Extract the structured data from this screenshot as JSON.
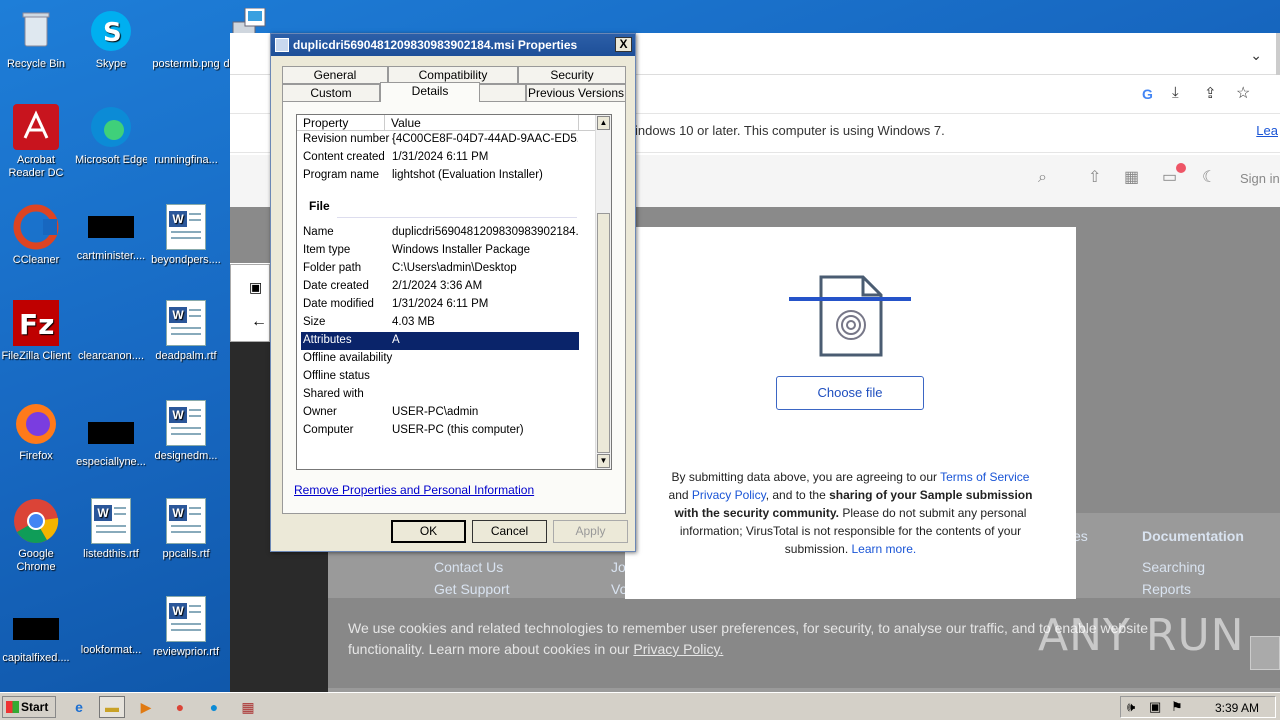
{
  "desktop": {
    "icons": [
      {
        "label": "Recycle Bin"
      },
      {
        "label": "Skype"
      },
      {
        "label": "postermb.png"
      },
      {
        "label": "duplicdri5"
      },
      {
        "label": "Acrobat Reader DC"
      },
      {
        "label": "Microsoft Edge"
      },
      {
        "label": "runningfina..."
      },
      {
        "label": "CCleaner"
      },
      {
        "label": "cartminister...."
      },
      {
        "label": "beyondpers...."
      },
      {
        "label": "FileZilla Client"
      },
      {
        "label": "clearcanon...."
      },
      {
        "label": "deadpalm.rtf"
      },
      {
        "label": "Firefox"
      },
      {
        "label": "especiallyne..."
      },
      {
        "label": "designedm..."
      },
      {
        "label": "Google Chrome"
      },
      {
        "label": "listedthis.rtf"
      },
      {
        "label": "ppcalls.rtf"
      },
      {
        "label": "capitalfixed...."
      },
      {
        "label": "lookformat..."
      },
      {
        "label": "reviewprior.rtf"
      }
    ]
  },
  "browser": {
    "info_text": "indows 10 or later. This computer is using Windows 7.",
    "info_link": "Lea",
    "signin": "Sign in",
    "footer": {
      "contact_us": "Contact Us",
      "get_support": "Get Support",
      "documentation": "Documentation",
      "searching": "Searching",
      "reports": "Reports",
      "jo": "Jo",
      "vo": "Vo",
      "es": "es"
    },
    "cookie_text": "We use cookies and related technologies to remember user preferences, for security, to analyse our traffic, and to enable website functionality. Learn more about cookies in our",
    "cookie_link": "Privacy Policy."
  },
  "modal": {
    "choose_file": "Choose file",
    "text_1": "By submitting data above, you are agreeing to our",
    "terms_link": "Terms of Service",
    "and": "and",
    "privacy_link": "Privacy Policy",
    "text_2": ", and to the",
    "bold": "sharing of your Sample submission with the security community.",
    "text_3": "Please do not submit any personal information; VirusTotal is not responsible for the contents of your submission.",
    "learn_more": "Learn more."
  },
  "dialog": {
    "title": "duplicdri5690481209830983902184.msi Properties",
    "close": "X",
    "tabs_row1": [
      "General",
      "Compatibility",
      "Security"
    ],
    "tabs_row2": [
      "Custom",
      "Details",
      "Previous Versions"
    ],
    "col_property": "Property",
    "col_value": "Value",
    "rows_top": [
      {
        "k": "Revision number",
        "v": "{4C00CE8F-04D7-44AD-9AAC-ED5..."
      },
      {
        "k": "Content created",
        "v": "1/31/2024 6:11 PM"
      },
      {
        "k": "Program name",
        "v": "lightshot (Evaluation Installer)"
      }
    ],
    "section_file": "File",
    "rows_file": [
      {
        "k": "Name",
        "v": "duplicdri5690481209830983902184..."
      },
      {
        "k": "Item type",
        "v": "Windows Installer Package"
      },
      {
        "k": "Folder path",
        "v": "C:\\Users\\admin\\Desktop"
      },
      {
        "k": "Date created",
        "v": "2/1/2024 3:36 AM"
      },
      {
        "k": "Date modified",
        "v": "1/31/2024 6:11 PM"
      },
      {
        "k": "Size",
        "v": "4.03 MB"
      },
      {
        "k": "Attributes",
        "v": "A"
      },
      {
        "k": "Offline availability",
        "v": ""
      },
      {
        "k": "Offline status",
        "v": ""
      },
      {
        "k": "Shared with",
        "v": ""
      },
      {
        "k": "Owner",
        "v": "USER-PC\\admin"
      },
      {
        "k": "Computer",
        "v": "USER-PC (this computer)"
      }
    ],
    "remove_link": "Remove Properties and Personal Information",
    "ok": "OK",
    "cancel": "Cancel",
    "apply": "Apply"
  },
  "taskbar": {
    "start": "Start",
    "clock": "3:39 AM"
  },
  "watermark": "ANY RUN"
}
